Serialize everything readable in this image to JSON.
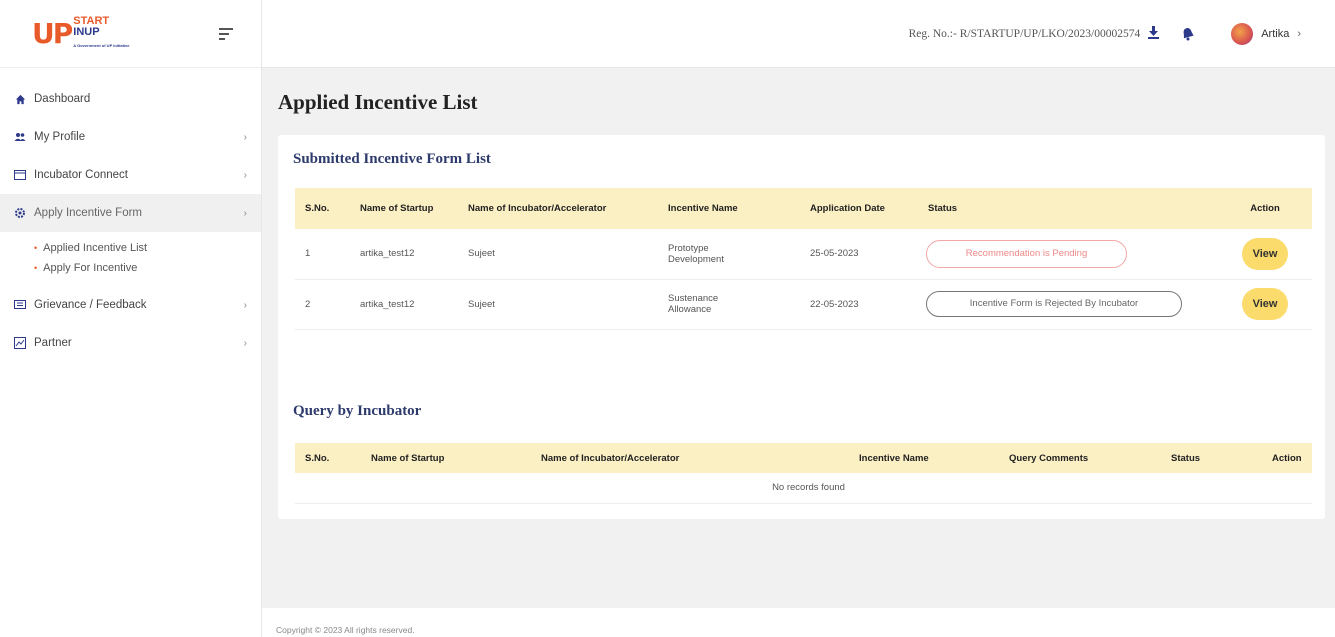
{
  "logo": {
    "line1": "START",
    "line2": "INUP",
    "tagline": "A Government of UP Initiative"
  },
  "sidebar": {
    "items": [
      {
        "label": "Dashboard",
        "icon": "home-icon"
      },
      {
        "label": "My Profile",
        "icon": "users-icon"
      },
      {
        "label": "Incubator Connect",
        "icon": "window-icon"
      },
      {
        "label": "Apply Incentive Form",
        "icon": "settings-icon"
      },
      {
        "label": "Grievance / Feedback",
        "icon": "message-icon"
      },
      {
        "label": "Partner",
        "icon": "partner-icon"
      }
    ],
    "sub_items": [
      {
        "label": "Applied Incentive List"
      },
      {
        "label": "Apply For Incentive"
      }
    ]
  },
  "header": {
    "reg_no": "Reg. No.:- R/STARTUP/UP/LKO/2023/00002574",
    "user_name": "Artika"
  },
  "page": {
    "title": "Applied Incentive List"
  },
  "submitted": {
    "title": "Submitted Incentive Form List",
    "columns": [
      "S.No.",
      "Name of Startup",
      "Name of Incubator/Accelerator",
      "Incentive Name",
      "Application Date",
      "Status",
      "Action"
    ],
    "rows": [
      {
        "sno": "1",
        "startup": "artika_test12",
        "incubator": "Sujeet",
        "incentive": "Prototype Development",
        "date": "25-05-2023",
        "status": "Recommendation is Pending",
        "action": "View"
      },
      {
        "sno": "2",
        "startup": "artika_test12",
        "incubator": "Sujeet",
        "incentive": "Sustenance Allowance",
        "date": "22-05-2023",
        "status": "Incentive Form is Rejected By Incubator",
        "action": "View"
      }
    ]
  },
  "query": {
    "title": "Query by Incubator",
    "columns": [
      "S.No.",
      "Name of Startup",
      "Name of Incubator/Accelerator",
      "Incentive Name",
      "Query Comments",
      "Status",
      "Action"
    ],
    "empty_text": "No records found"
  },
  "footer": {
    "text": "Copyright © 2023 All rights reserved."
  },
  "colors": {
    "accent": "#2d3a8c",
    "brand_orange": "#e85a2a",
    "table_header": "#fbefc4",
    "button": "#fbdb6c",
    "pending": "#e88888"
  }
}
